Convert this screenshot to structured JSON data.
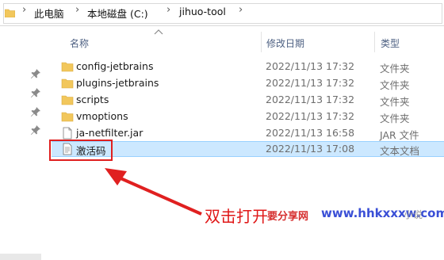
{
  "address": {
    "crumbs": [
      "此电脑",
      "本地磁盘 (C:)",
      "jihuo-tool"
    ],
    "separator": "›"
  },
  "columns": {
    "name": "名称",
    "date": "修改日期",
    "type": "类型"
  },
  "files": [
    {
      "name": "config-jetbrains",
      "date": "2022/11/13 17:32",
      "type": "文件夹",
      "icon": "folder-icon"
    },
    {
      "name": "plugins-jetbrains",
      "date": "2022/11/13 17:32",
      "type": "文件夹",
      "icon": "folder-icon"
    },
    {
      "name": "scripts",
      "date": "2022/11/13 17:32",
      "type": "文件夹",
      "icon": "folder-icon"
    },
    {
      "name": "vmoptions",
      "date": "2022/11/13 17:32",
      "type": "文件夹",
      "icon": "folder-icon"
    },
    {
      "name": "ja-netfilter.jar",
      "date": "2022/11/13 16:58",
      "type": "JAR 文件",
      "icon": "jar-file-icon"
    },
    {
      "name": "激活码",
      "date": "2022/11/13 17:08",
      "type": "文本文档",
      "icon": "text-document-icon",
      "selected": true
    }
  ],
  "annotation": {
    "text": "双击打开",
    "color": "#e01818"
  },
  "watermark": {
    "part1": "要分享网",
    "part2": "www.hhkxxxw.com",
    "part3": "小说"
  },
  "colors": {
    "selection": "#cce8ff",
    "selection_border": "#99d1ff",
    "folder": "#f2c75c",
    "header_text": "#4d6082"
  }
}
